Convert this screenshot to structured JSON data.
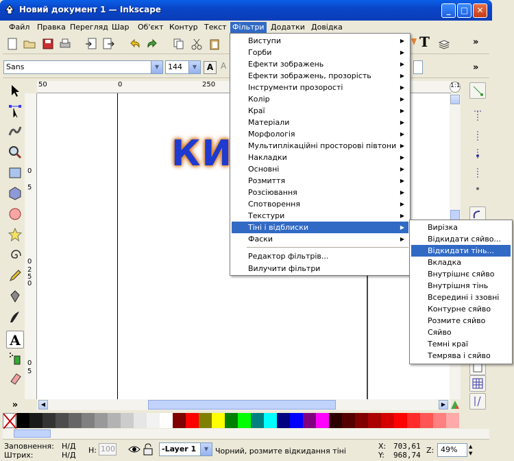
{
  "window": {
    "title": "Новий документ 1 — Inkscape",
    "minimize": "_",
    "maximize": "□",
    "close": "✕"
  },
  "menubar": [
    "Файл",
    "Правка",
    "Перегляд",
    "Шар",
    "Об'єкт",
    "Контур",
    "Текст",
    "Фільтри",
    "Додатки",
    "Довідка"
  ],
  "textbar": {
    "font_family": "Sans",
    "font_size": "144"
  },
  "rulers": {
    "top_ticks": [
      "50",
      "0",
      "250"
    ],
    "left_ticks": [
      "0",
      "5",
      "0",
      "2",
      "5",
      "0",
      "0",
      "5"
    ]
  },
  "canvas_text": "КИ",
  "filters_menu": {
    "items": [
      "Виступи",
      "Горби",
      "Ефекти зображень",
      "Ефекти зображень, прозорість",
      "Інструменти прозорості",
      "Колір",
      "Краї",
      "Матеріали",
      "Морфологія",
      "Мультиплікаційні просторові півтони",
      "Накладки",
      "Основні",
      "Розмиття",
      "Розсіювання",
      "Спотворення",
      "Текстури",
      "Тіні і відблиски",
      "Фаски"
    ],
    "selected": "Тіні і відблиски",
    "extra": [
      "Редактор фільтрів...",
      "Вилучити фільтри"
    ]
  },
  "shadows_submenu": {
    "items": [
      "Вирізка",
      "Відкидати сяйво...",
      "Відкидати тінь...",
      "Вкладка",
      "Внутрішнє сяйво",
      "Внутрішня тінь",
      "Всередині і ззовні",
      "Контурне сяйво",
      "Розмите сяйво",
      "Сяйво",
      "Темні краї",
      "Темрява і сяйво"
    ],
    "selected": "Відкидати тінь..."
  },
  "status": {
    "fill_label": "Заповнення:",
    "fill_value": "Н/Д",
    "stroke_label": "Штрих:",
    "stroke_value": "Н/Д",
    "h_label": "Н:",
    "h_value": "100",
    "layer": "-Layer 1",
    "message": "Чорний, розмите відкидання тіні",
    "x_label": "X:",
    "x_value": "703,61",
    "y_label": "Y:",
    "y_value": "968,74",
    "zoom_label": "Z:",
    "zoom_value": "49%"
  },
  "toolbar_overflow": "»",
  "colors": {
    "accent": "#316ac5",
    "titlebar": "#0a46c8",
    "palette": [
      "#000000",
      "#1a1a1a",
      "#333333",
      "#4d4d4d",
      "#666666",
      "#808080",
      "#999999",
      "#b3b3b3",
      "#cccccc",
      "#e6e6e6",
      "#f2f2f2",
      "#ffffff",
      "#800000",
      "#ff0000",
      "#808000",
      "#ffff00",
      "#008000",
      "#00ff00",
      "#008080",
      "#00ffff",
      "#000080",
      "#0000ff",
      "#800080",
      "#ff00ff",
      "#2b0000",
      "#550000",
      "#800000",
      "#aa0000",
      "#d40000",
      "#ff0000",
      "#ff2a2a",
      "#ff5555",
      "#ff8080",
      "#ffaaaa"
    ]
  }
}
